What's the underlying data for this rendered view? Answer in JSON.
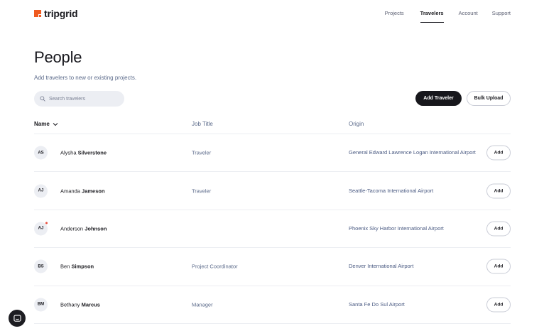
{
  "brand": {
    "name": "tripgrid",
    "accent": "#ef5a1f"
  },
  "nav": [
    {
      "label": "Projects",
      "active": false
    },
    {
      "label": "Travelers",
      "active": true
    },
    {
      "label": "Account",
      "active": false
    },
    {
      "label": "Support",
      "active": false
    }
  ],
  "page": {
    "title": "People",
    "subtitle": "Add travelers to new or existing projects."
  },
  "search": {
    "placeholder": "Search travelers",
    "value": ""
  },
  "actions": {
    "add_traveler": "Add Traveler",
    "bulk_upload": "Bulk Upload"
  },
  "table": {
    "columns": {
      "name": "Name",
      "job_title": "Job Title",
      "origin": "Origin"
    },
    "rows": [
      {
        "initials": "AS",
        "first": "Alysha",
        "last": "Silverstone",
        "job_title": "Traveler",
        "origin": "General Edward Lawrence Logan International Airport",
        "notification": false,
        "action": "Add"
      },
      {
        "initials": "AJ",
        "first": "Amanda",
        "last": "Jameson",
        "job_title": "Traveler",
        "origin": "Seattle-Tacoma International Airport",
        "notification": false,
        "action": "Add"
      },
      {
        "initials": "AJ",
        "first": "Anderson",
        "last": "Johnson",
        "job_title": "",
        "origin": "Phoenix Sky Harbor International Airport",
        "notification": true,
        "action": "Add"
      },
      {
        "initials": "BS",
        "first": "Ben",
        "last": "Simpson",
        "job_title": "Project Coordinator",
        "origin": "Denver International Airport",
        "notification": false,
        "action": "Add"
      },
      {
        "initials": "BM",
        "first": "Bethany",
        "last": "Marcus",
        "job_title": "Manager",
        "origin": "Santa Fe Do Sul Airport",
        "notification": false,
        "action": "Add"
      }
    ]
  },
  "icons": {
    "search": "search-icon",
    "sort": "chevron-down-icon",
    "chat": "chat-icon"
  }
}
